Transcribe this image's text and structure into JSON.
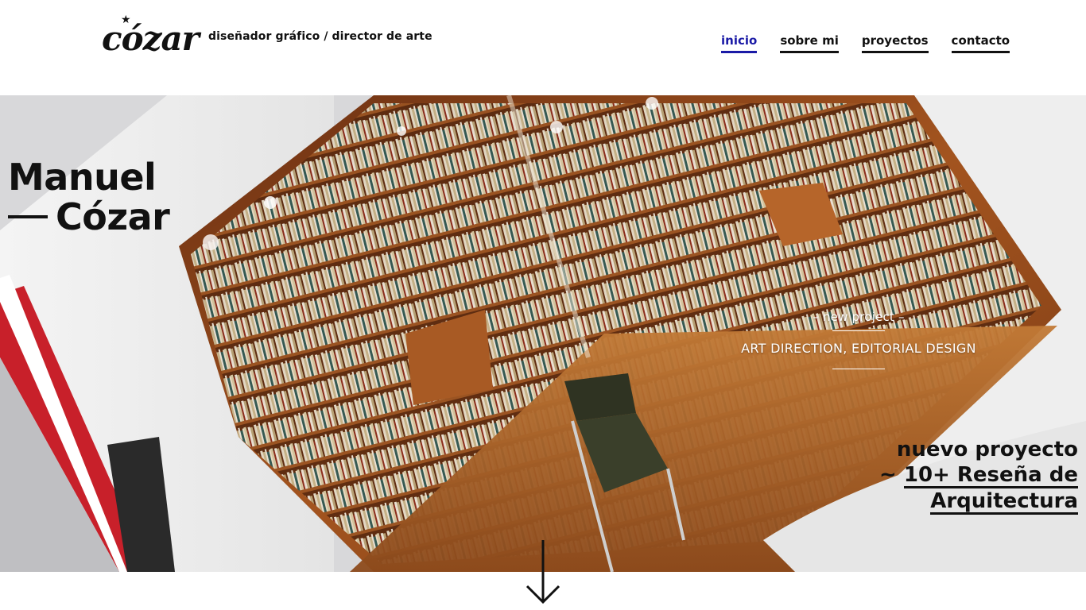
{
  "header": {
    "logo_text": "cózar",
    "logo_star": "★",
    "tagline": "diseñador gráfico / director de arte"
  },
  "nav": {
    "items": [
      {
        "label": "inicio",
        "active": true
      },
      {
        "label": "sobre mi",
        "active": false
      },
      {
        "label": "proyectos",
        "active": false
      },
      {
        "label": "contacto",
        "active": false
      }
    ]
  },
  "hero": {
    "name_first": "Manuel",
    "name_last": "Cózar",
    "feature_kicker": "– new project –",
    "feature_title": "ART DIRECTION, EDITORIAL DESIGN",
    "nuevo_label": "nuevo proyecto",
    "nuevo_prefix": "~ ",
    "nuevo_link_line1": "10+ Reseña de",
    "nuevo_link_line2": "Arquitectura",
    "scroll_icon": "arrow-down-icon"
  },
  "colors": {
    "nav_active": "#1a1aa6",
    "text": "#111111",
    "accent_red": "#c8202a",
    "wood": "#9a4f1e"
  }
}
